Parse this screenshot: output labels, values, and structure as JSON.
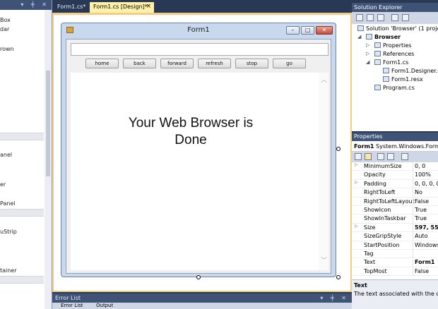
{
  "toolbox": {
    "header_buttons": "▾ ╪ ✕",
    "items": [
      {
        "label": "Box"
      },
      {
        "label": "dar"
      },
      {
        "label": "rown"
      },
      {
        "label": "anel"
      },
      {
        "label": "er"
      },
      {
        "label": "Panel"
      },
      {
        "label": "uStrip"
      },
      {
        "label": "tainer"
      }
    ]
  },
  "tabs": [
    {
      "label": "Form1.cs*"
    },
    {
      "label": "Form1.cs [Design]*",
      "close": "×"
    }
  ],
  "form": {
    "title": "Form1",
    "min_label": "–",
    "max_label": "□",
    "close_label": "✕",
    "url_value": "",
    "nav_buttons": [
      "home",
      "back",
      "forward",
      "refresh",
      "stop",
      "go"
    ],
    "message_line1": "Your Web Browser is",
    "message_line2": "Done",
    "scroll_up": "︿",
    "scroll_down": "﹀"
  },
  "error_list": {
    "title": "Error List",
    "header_buttons": "▾ ╪ ✕",
    "tabs": [
      "Error List",
      "Output"
    ]
  },
  "solution_explorer": {
    "title": "Solution Explorer",
    "items": [
      {
        "label": "Solution 'Browser' (1 project)"
      },
      {
        "label": "Browser"
      },
      {
        "label": "Properties"
      },
      {
        "label": "References"
      },
      {
        "label": "Form1.cs"
      },
      {
        "label": "Form1.Designer.cs"
      },
      {
        "label": "Form1.resx"
      },
      {
        "label": "Program.cs"
      }
    ]
  },
  "properties": {
    "title": "Properties",
    "selected_object": "Form1",
    "selected_type": "System.Windows.Forms.Fo",
    "rows": [
      {
        "name": "MinimumSize",
        "value": "0, 0",
        "expand": "▷"
      },
      {
        "name": "Opacity",
        "value": "100%",
        "expand": ""
      },
      {
        "name": "Padding",
        "value": "0, 0, 0, 0",
        "expand": "▷"
      },
      {
        "name": "RightToLeft",
        "value": "No",
        "expand": ""
      },
      {
        "name": "RightToLeftLayout",
        "value": "False",
        "expand": ""
      },
      {
        "name": "ShowIcon",
        "value": "True",
        "expand": ""
      },
      {
        "name": "ShowInTaskbar",
        "value": "True",
        "expand": ""
      },
      {
        "name": "Size",
        "value": "597, 552",
        "expand": "▷"
      },
      {
        "name": "SizeGripStyle",
        "value": "Auto",
        "expand": ""
      },
      {
        "name": "StartPosition",
        "value": "WindowsD",
        "expand": ""
      },
      {
        "name": "Tag",
        "value": "",
        "expand": ""
      },
      {
        "name": "Text",
        "value": "Form1",
        "expand": ""
      },
      {
        "name": "TopMost",
        "value": "False",
        "expand": ""
      }
    ],
    "desc_title": "Text",
    "desc_text": "The text associated with the contro"
  },
  "colors": {
    "ide_background": "#293955",
    "panel_header": "#3f5377",
    "active_tab": "#fff1a8",
    "designer_border": "#f5cc84"
  }
}
